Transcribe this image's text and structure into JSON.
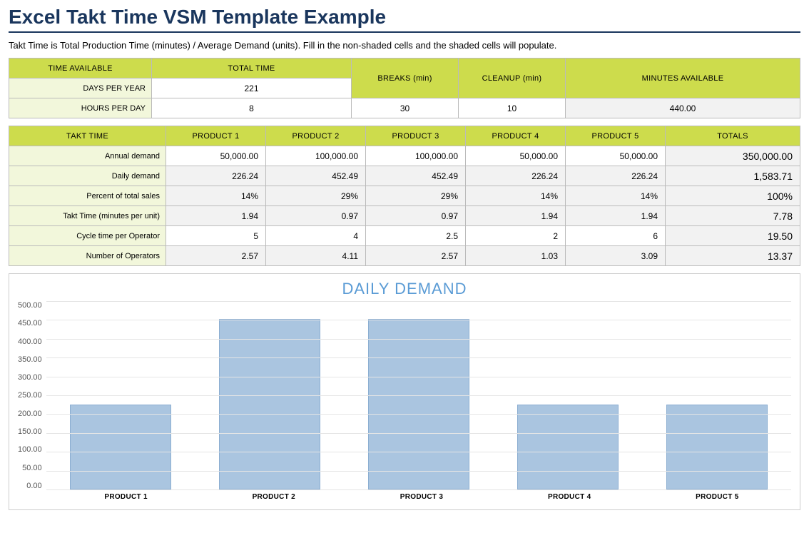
{
  "title": "Excel Takt Time VSM Template Example",
  "subtitle": "Takt Time is Total Production Time (minutes) / Average Demand (units). Fill in the non-shaded cells and the shaded cells will populate.",
  "time_table": {
    "headers": {
      "time_available": "TIME AVAILABLE",
      "total_time": "TOTAL TIME",
      "breaks": "BREAKS (min)",
      "cleanup": "CLEANUP (min)",
      "minutes_available": "MINUTES AVAILABLE"
    },
    "rows": {
      "days_per_year_label": "DAYS PER YEAR",
      "days_per_year_value": "221",
      "hours_per_day_label": "HOURS PER DAY",
      "hours_per_day_value": "8",
      "breaks_value": "30",
      "cleanup_value": "10",
      "minutes_value": "440.00"
    }
  },
  "takt_table": {
    "header_label": "TAKT TIME",
    "product_headers": [
      "PRODUCT 1",
      "PRODUCT 2",
      "PRODUCT 3",
      "PRODUCT 4",
      "PRODUCT 5"
    ],
    "totals_header": "TOTALS",
    "rows": [
      {
        "label": "Annual demand",
        "vals": [
          "50,000.00",
          "100,000.00",
          "100,000.00",
          "50,000.00",
          "50,000.00"
        ],
        "total": "350,000.00",
        "shade": "white"
      },
      {
        "label": "Daily demand",
        "vals": [
          "226.24",
          "452.49",
          "452.49",
          "226.24",
          "226.24"
        ],
        "total": "1,583.71",
        "shade": "grey"
      },
      {
        "label": "Percent of total sales",
        "vals": [
          "14%",
          "29%",
          "29%",
          "14%",
          "14%"
        ],
        "total": "100%",
        "shade": "grey"
      },
      {
        "label": "Takt Time (minutes per unit)",
        "vals": [
          "1.94",
          "0.97",
          "0.97",
          "1.94",
          "1.94"
        ],
        "total": "7.78",
        "shade": "grey"
      },
      {
        "label": "Cycle time per Operator",
        "vals": [
          "5",
          "4",
          "2.5",
          "2",
          "6"
        ],
        "total": "19.50",
        "shade": "white"
      },
      {
        "label": "Number of Operators",
        "vals": [
          "2.57",
          "4.11",
          "2.57",
          "1.03",
          "3.09"
        ],
        "total": "13.37",
        "shade": "grey"
      }
    ]
  },
  "chart_data": {
    "type": "bar",
    "title": "DAILY DEMAND",
    "categories": [
      "PRODUCT 1",
      "PRODUCT 2",
      "PRODUCT 3",
      "PRODUCT 4",
      "PRODUCT 5"
    ],
    "values": [
      226.24,
      452.49,
      452.49,
      226.24,
      226.24
    ],
    "ylim": [
      0,
      500
    ],
    "yticks": [
      "500.00",
      "450.00",
      "400.00",
      "350.00",
      "300.00",
      "250.00",
      "200.00",
      "150.00",
      "100.00",
      "50.00",
      "0.00"
    ],
    "xlabel": "",
    "ylabel": ""
  }
}
